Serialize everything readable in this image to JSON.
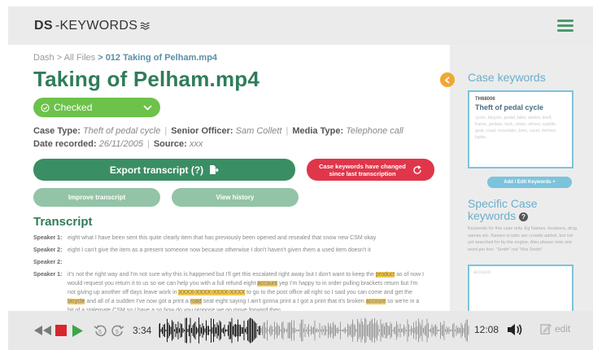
{
  "header": {
    "logo_ds": "DS",
    "logo_rest": "-KEYWORDS"
  },
  "breadcrumb": {
    "part1": "Dash",
    "sep1": " > ",
    "part2": "All Files",
    "sep2": " > ",
    "current": "012 Taking of Pelham.mp4"
  },
  "title": "Taking of Pelham.mp4",
  "status": {
    "label": "Checked"
  },
  "meta": {
    "case_type_label": "Case Type:",
    "case_type": "Theft of pedal cycle",
    "officer_label": "Senior Officer:",
    "officer": "Sam Collett",
    "media_label": "Media Type:",
    "media": "Telephone call",
    "date_label": "Date recorded:",
    "date": "26/11/2005",
    "source_label": "Source:",
    "source": "xxx"
  },
  "buttons": {
    "export": "Export transcript (?)",
    "changed_line1": "Case keywords have changed",
    "changed_line2": "since last transcription",
    "improve": "Improve transcript",
    "history": "View history"
  },
  "transcript": {
    "title": "Transcript",
    "lines": [
      {
        "speaker": "Speaker 1:",
        "text": "eight what I have been sent this quite clearly item that has previously been opened and resealed that snow new CSM okay"
      },
      {
        "speaker": "Speaker 2:",
        "text": "eight I can't give the item as a present someone now because otherwise I don't haven't given them a used item doesn't it"
      },
      {
        "speaker": "Speaker 2:",
        "text": ""
      },
      {
        "speaker": "Speaker 1:",
        "text": ""
      }
    ],
    "line4": {
      "a": "it's not the right way and I'm not sure why this is happened but I'll get this escalated right away but I don't want to keep the ",
      "hl1": "product",
      "b": " as of now I would request you return it to us so we can help you with a full refund eight ",
      "hl2": "account",
      "c": " yep I'm happy to in order pulling brackets return but I'm not giving up another off days leave work in ",
      "hl3": "XXXX-XXXX-XXXX-XXXX",
      "d": " to go to the post office all right so I said you can come and get the ",
      "hl4": "bicycle",
      "e": " and all of a sudden I've now got a print a ",
      "hl5": "road",
      "f": " seat eight saying I ain't gonna print a I got a print that it's broken ",
      "hl6": "account",
      "g": " so we're in a bit of a stalemate CSM so I have a so how do you propose we go move forward then"
    }
  },
  "sidebar": {
    "case_keywords_title": "Case keywords",
    "case_code": "TH68006",
    "case_name": "Theft of pedal cycle",
    "case_words": "cycle, bicycle, pedal, bike, stolen, theft, frame, pedals, lock, chain, wheel, saddle, gear, road, mountain, bmx, racer, helmet, lights",
    "add_edit": "Add / Edit Keywords +",
    "specific_title_1": "Specific Case",
    "specific_title_2": "keywords",
    "specific_desc": "Keywords for this case only. Eg Names, locations, drug names etc. Names in italic are crowds added, but not yet searched for by the engine. Also please note one word per line: \"Smith\" not \"Mrs Smith\"",
    "specific_placeholder": "account"
  },
  "player": {
    "current_time": "3:34",
    "total_time": "12:08",
    "edit_label": "edit"
  },
  "colors": {
    "primary_green": "#2f7d5a",
    "button_green": "#3a8e63",
    "status_green": "#6cc24a",
    "alert_red": "#e0364a",
    "accent_blue": "#6aaecb",
    "highlight": "#f2c84b",
    "collapse_orange": "#f0a833"
  },
  "icons": [
    "logo-waves-icon",
    "hamburger-menu-icon",
    "check-circle-icon",
    "chevron-down-icon",
    "export-icon",
    "refresh-icon",
    "chevron-left-icon",
    "help-icon",
    "rewind-icon",
    "stop-icon",
    "play-icon",
    "replay-5-icon",
    "forward-5-icon",
    "volume-icon",
    "edit-icon"
  ]
}
